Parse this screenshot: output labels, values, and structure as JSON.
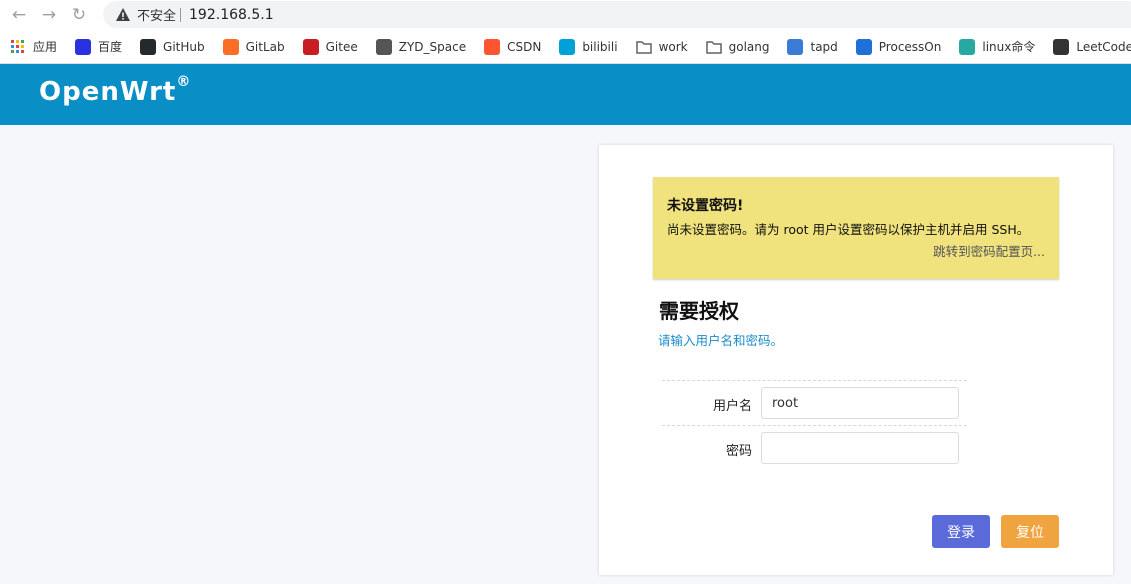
{
  "browser": {
    "nav": {
      "back": "←",
      "forward": "→",
      "reload": "↻"
    },
    "security_label": "不安全",
    "url": "192.168.5.1"
  },
  "bookmarks": [
    {
      "label": "应用",
      "icon": "apps-grid-icon",
      "color": "#e94235"
    },
    {
      "label": "百度",
      "icon": "baidu-icon",
      "color": "#2932e1"
    },
    {
      "label": "GitHub",
      "icon": "github-icon",
      "color": "#24292e"
    },
    {
      "label": "GitLab",
      "icon": "gitlab-icon",
      "color": "#fc6d26"
    },
    {
      "label": "Gitee",
      "icon": "gitee-icon",
      "color": "#c71d23"
    },
    {
      "label": "ZYD_Space",
      "icon": "globe-icon",
      "color": "#555555"
    },
    {
      "label": "CSDN",
      "icon": "csdn-icon",
      "color": "#fc5531"
    },
    {
      "label": "bilibili",
      "icon": "bilibili-icon",
      "color": "#00a1d6"
    },
    {
      "label": "work",
      "icon": "folder-icon",
      "color": "#5f6368"
    },
    {
      "label": "golang",
      "icon": "folder-icon",
      "color": "#5f6368"
    },
    {
      "label": "tapd",
      "icon": "tapd-icon",
      "color": "#3a7bd5"
    },
    {
      "label": "ProcessOn",
      "icon": "processon-icon",
      "color": "#1f6fd9"
    },
    {
      "label": "linux命令",
      "icon": "linux-icon",
      "color": "#27a9a1"
    },
    {
      "label": "LeetCode",
      "icon": "leetcode-icon",
      "color": "#333333"
    }
  ],
  "header": {
    "brand": "OpenWrt",
    "mark": "®"
  },
  "alert": {
    "title": "未设置密码!",
    "message": "尚未设置密码。请为 root 用户设置密码以保护主机并启用 SSH。",
    "link": "跳转到密码配置页..."
  },
  "auth": {
    "title": "需要授权",
    "subtitle": "请输入用户名和密码。",
    "username_label": "用户名",
    "username_value": "root",
    "password_label": "密码",
    "password_value": ""
  },
  "buttons": {
    "login": "登录",
    "reset": "复位"
  },
  "colors": {
    "header": "#0a8ec6",
    "alert": "#f0e27c",
    "login": "#5a6ad8",
    "reset": "#efa440",
    "link": "#1b8cc9"
  }
}
